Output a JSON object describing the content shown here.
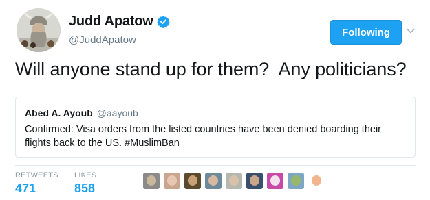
{
  "author": {
    "name": "Judd Apatow",
    "handle": "@JuddApatow"
  },
  "follow_button": {
    "label": "Following",
    "color": "#1da1f2"
  },
  "tweet": {
    "text": "Will anyone stand up for them?  Any politicians?"
  },
  "quoted_tweet": {
    "name": "Abed A. Ayoub",
    "handle": "@aayoub",
    "text": "Confirmed: Visa orders from the listed countries have been denied boarding their flights back to the US. #MuslimBan"
  },
  "stats": {
    "retweets_label": "RETWEETS",
    "retweets_value": "471",
    "likes_label": "LIKES",
    "likes_value": "858"
  },
  "likers": [
    {
      "bg": "#8c8a88",
      "fg": "#c9b79c"
    },
    {
      "bg": "#c9a48e",
      "fg": "#e8c7b2"
    },
    {
      "bg": "#5a4a2e",
      "fg": "#caa176"
    },
    {
      "bg": "#6d8a9b",
      "fg": "#d7b8a0"
    },
    {
      "bg": "#b6b8b0",
      "fg": "#d8c2aa"
    },
    {
      "bg": "#3a4f6b",
      "fg": "#cba68b"
    },
    {
      "bg": "#c84aa6",
      "fg": "#f1e2ee"
    },
    {
      "bg": "#7fa7c4",
      "fg": "#97b86a"
    },
    {
      "bg": "#ffffff",
      "fg": "#f2b48c"
    }
  ],
  "colors": {
    "text": "#14171a",
    "secondary": "#657786",
    "accent": "#1da1f2",
    "border": "#e1e8ed"
  }
}
